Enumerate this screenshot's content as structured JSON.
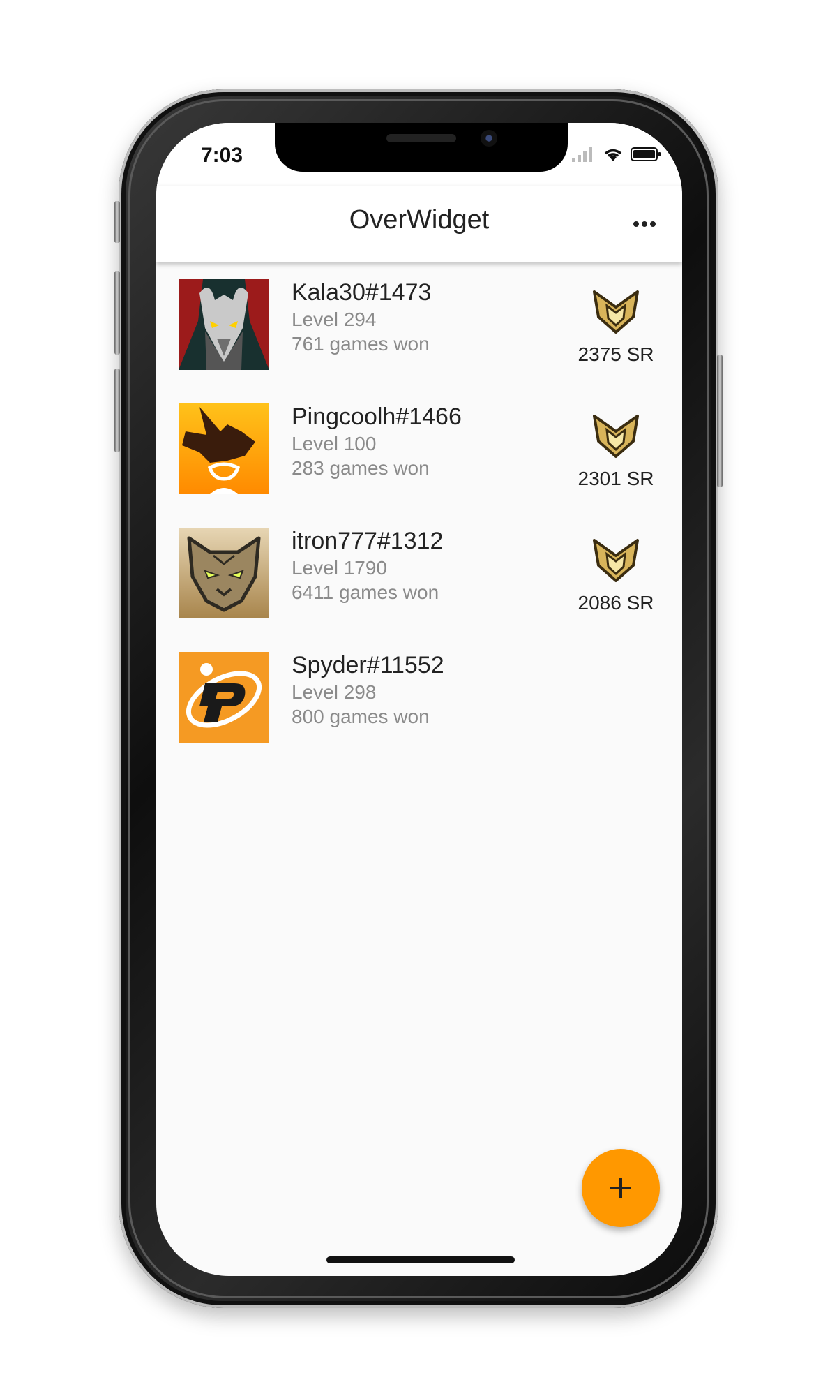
{
  "status_bar": {
    "time": "7:03"
  },
  "app_bar": {
    "title": "OverWidget",
    "menu_icon": "more-horizontal-icon"
  },
  "players": [
    {
      "name": "Kala30#1473",
      "level": "Level 294",
      "games_won": "761 games won",
      "sr": "2375 SR",
      "rank_icon": "gold-rank-icon",
      "avatar_icon": "demon-mask-avatar"
    },
    {
      "name": "Pingcoolh#1466",
      "level": "Level 100",
      "games_won": "283 games won",
      "sr": "2301 SR",
      "rank_icon": "gold-rank-icon",
      "avatar_icon": "tracer-avatar"
    },
    {
      "name": "itron777#1312",
      "level": "Level 1790",
      "games_won": "6411 games won",
      "sr": "2086 SR",
      "rank_icon": "gold-rank-icon",
      "avatar_icon": "panther-avatar"
    },
    {
      "name": "Spyder#11552",
      "level": "Level 298",
      "games_won": "800 games won",
      "sr": "",
      "rank_icon": "",
      "avatar_icon": "philadelphia-fusion-avatar"
    }
  ],
  "fab": {
    "icon": "plus-icon"
  },
  "colors": {
    "accent": "#ff9800",
    "background": "#fafafa",
    "app_bar": "#ffffff",
    "primary_text": "#222222",
    "secondary_text": "#8a8a8a",
    "rank_gold": "#c9a54a"
  }
}
